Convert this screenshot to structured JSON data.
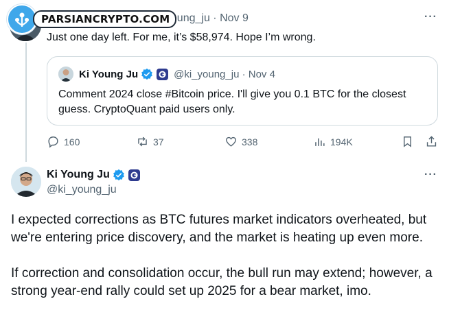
{
  "watermark": {
    "text": "PARSIANCRYPTO.COM"
  },
  "reply_tweet": {
    "handle_time": "_young_ju · Nov 9",
    "text": "Just one day left. For me, it’s $58,974. Hope I’m wrong.",
    "more_label": "···"
  },
  "quoted_tweet": {
    "name": "Ki Young Ju",
    "handle_time": "@ki_young_ju · Nov 4",
    "text": "Comment 2024 close #Bitcoin price. I'll give you 0.1 BTC for the closest guess. CryptoQuant paid users only."
  },
  "actions": {
    "replies": "160",
    "reposts": "37",
    "likes": "338",
    "views": "194K"
  },
  "main_tweet": {
    "name": "Ki Young Ju",
    "handle": "@ki_young_ju",
    "more_label": "···",
    "paragraph1": "I expected corrections as BTC futures market indicators overheated, but we're entering price discovery, and the market is heating up even more.",
    "paragraph2": "If correction and consolidation occur, the bull run may extend; however, a strong year-end rally could set up 2025 for a bear market, imo."
  },
  "colors": {
    "verified": "#1d9bf0",
    "secondary_text": "#536471",
    "border": "#cfd9de",
    "badge": "#2e3b8f"
  },
  "icons": [
    "reply-icon",
    "repost-icon",
    "like-icon",
    "views-icon",
    "bookmark-icon",
    "share-icon",
    "verified-icon",
    "cryptoquant-badge-icon",
    "more-icon"
  ]
}
